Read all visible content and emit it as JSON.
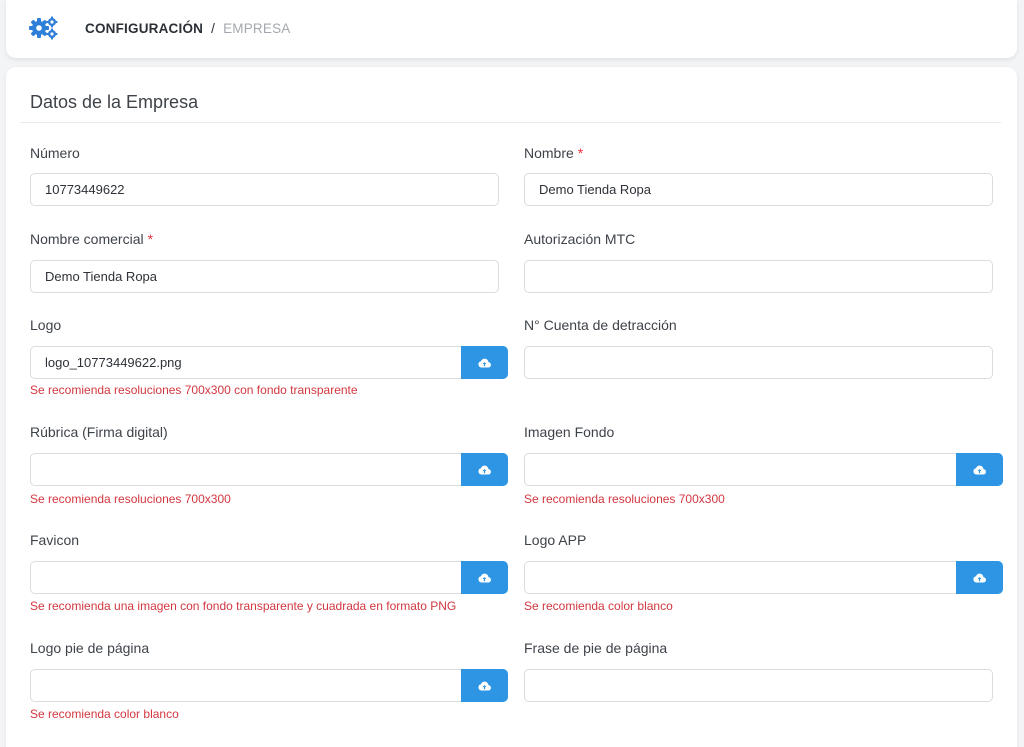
{
  "header": {
    "icon": "gears-icon",
    "breadcrumb_1": "CONFIGURACIÓN",
    "separator": "/",
    "breadcrumb_2": "EMPRESA"
  },
  "card": {
    "title": "Datos de la Empresa"
  },
  "required_mark": "*",
  "fields": {
    "numero": {
      "label": "Número",
      "value": "10773449622"
    },
    "nombre": {
      "label": "Nombre",
      "value": "Demo Tienda Ropa"
    },
    "nombre_comercial": {
      "label": "Nombre comercial",
      "value": "Demo Tienda Ropa"
    },
    "autorizacion_mtc": {
      "label": "Autorización MTC",
      "value": ""
    },
    "logo": {
      "label": "Logo",
      "value": "logo_10773449622.png",
      "hint": "Se recomienda resoluciones 700x300 con fondo transparente"
    },
    "cuenta_detraccion": {
      "label": "N° Cuenta de detracción",
      "value": ""
    },
    "rubrica": {
      "label": "Rúbrica (Firma digital)",
      "value": "",
      "hint": "Se recomienda resoluciones 700x300"
    },
    "imagen_fondo": {
      "label": "Imagen Fondo",
      "value": "",
      "hint": "Se recomienda resoluciones 700x300"
    },
    "favicon": {
      "label": "Favicon",
      "value": "",
      "hint": "Se recomienda una imagen con fondo transparente y cuadrada en formato PNG"
    },
    "logo_app": {
      "label": "Logo APP",
      "value": "",
      "hint": "Se recomienda color blanco"
    },
    "logo_pie": {
      "label": "Logo pie de página",
      "value": "",
      "hint": "Se recomienda color blanco"
    },
    "frase_pie": {
      "label": "Frase de pie de página",
      "value": ""
    }
  },
  "colors": {
    "accent": "#2d95e4",
    "error": "#d2373f",
    "required": "#e0323c"
  },
  "upload_icon": "cloud-upload-icon"
}
